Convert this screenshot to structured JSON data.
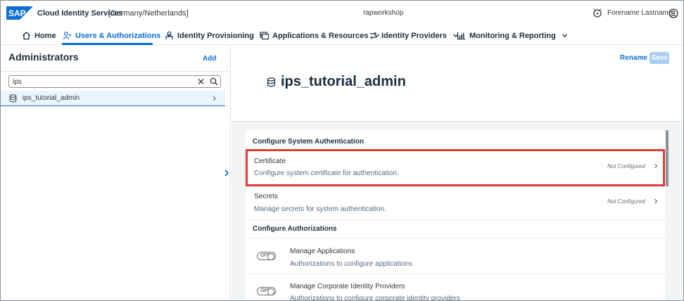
{
  "colors": {
    "accent": "#0a6ed1",
    "highlight": "#e03c3c",
    "brand_blue": "#0a6ed1"
  },
  "shell": {
    "logo_text": "SAP",
    "title": "Cloud Identity Services",
    "region": "[Germany/Netherlands]",
    "tenant": "rapworkshop",
    "user": "Forename Lastname"
  },
  "nav": {
    "tabs": [
      {
        "label": "Home",
        "icon": "home-icon"
      },
      {
        "label": "Users & Authorizations",
        "icon": "users-icon",
        "active": true
      },
      {
        "label": "Identity Provisioning",
        "icon": "provisioning-icon"
      },
      {
        "label": "Applications & Resources",
        "icon": "applications-icon"
      },
      {
        "label": "Identity Providers",
        "icon": "identity-providers-icon"
      },
      {
        "label": "Monitoring & Reporting",
        "icon": "monitoring-icon"
      }
    ]
  },
  "left": {
    "title": "Administrators",
    "add_label": "Add",
    "search_value": "ips",
    "items": [
      {
        "label": "ips_tutorial_admin",
        "icon": "database-icon"
      }
    ]
  },
  "detail": {
    "title": "ips_tutorial_admin",
    "rename_label": "Rename",
    "save_label": "Save",
    "system_auth": {
      "title": "Configure System Authentication",
      "rows": [
        {
          "title": "Certificate",
          "subtitle": "Configure system certificate for authentication.",
          "status": "Not Configured"
        },
        {
          "title": "Secrets",
          "subtitle": "Manage secrets for system authentication.",
          "status": "Not Configured"
        }
      ]
    },
    "authorizations": {
      "title": "Configure Authorizations",
      "rows": [
        {
          "title": "Manage Applications",
          "subtitle": "Authorizations to configure applications",
          "toggle": "OFF"
        },
        {
          "title": "Manage Corporate Identity Providers",
          "subtitle": "Authorizations to configure corporate identity providers",
          "toggle": "OFF"
        }
      ]
    }
  }
}
